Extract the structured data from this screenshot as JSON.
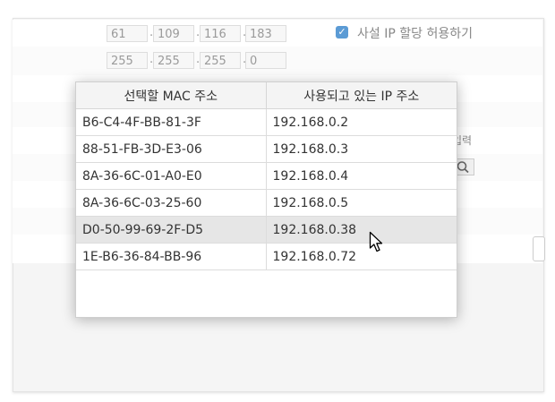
{
  "background_form": {
    "ip_address": [
      "61",
      "109",
      "116",
      "183"
    ],
    "subnet_mask": [
      "255",
      "255",
      "255",
      "0"
    ],
    "private_ip_checkbox": {
      "checked": true,
      "label": "사설 IP 할당 허용하기"
    },
    "partial_label": "입력"
  },
  "popup": {
    "columns": [
      "선택할 MAC 주소",
      "사용되고 있는 IP 주소"
    ],
    "rows": [
      {
        "mac": "B6-C4-4F-BB-81-3F",
        "ip": "192.168.0.2"
      },
      {
        "mac": "88-51-FB-3D-E3-06",
        "ip": "192.168.0.3"
      },
      {
        "mac": "8A-36-6C-01-A0-E0",
        "ip": "192.168.0.4"
      },
      {
        "mac": "8A-36-6C-03-25-60",
        "ip": "192.168.0.5"
      },
      {
        "mac": "D0-50-99-69-2F-D5",
        "ip": "192.168.0.38"
      },
      {
        "mac": "1E-B6-36-84-BB-96",
        "ip": "192.168.0.72"
      }
    ],
    "highlighted_row": 4
  },
  "icons": {
    "check": "check-icon",
    "search": "search-icon",
    "cursor": "mouse-pointer-icon"
  },
  "colors": {
    "checkbox_accent": "#5b9bd5",
    "row_highlight": "#e6e6e6"
  }
}
